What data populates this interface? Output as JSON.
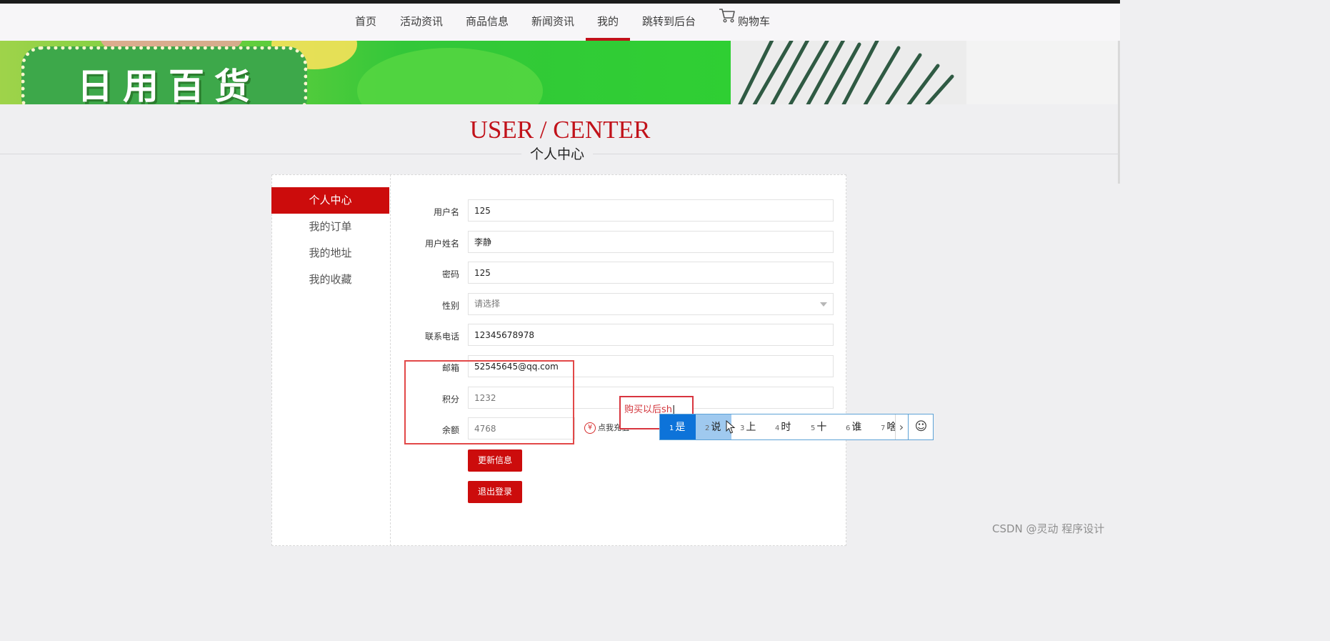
{
  "nav": {
    "items": [
      "首页",
      "活动资讯",
      "商品信息",
      "新闻资讯",
      "我的",
      "跳转到后台"
    ],
    "cart_label": "购物车",
    "active_item": "我的"
  },
  "banner": {
    "text": "日用百货"
  },
  "heading": {
    "en": "USER / CENTER",
    "cn": "个人中心"
  },
  "sidebar": {
    "items": [
      "个人中心",
      "我的订单",
      "我的地址",
      "我的收藏"
    ]
  },
  "form": {
    "username_label": "用户名",
    "username_value": "125",
    "realname_label": "用户姓名",
    "realname_value": "李静",
    "password_label": "密码",
    "password_value": "125",
    "gender_label": "性别",
    "gender_placeholder": "请选择",
    "phone_label": "联系电话",
    "phone_value": "12345678978",
    "email_label": "邮箱",
    "email_value": "52545645@qq.com",
    "points_label": "积分",
    "points_value": "1232",
    "balance_label": "余额",
    "balance_value": "4768",
    "recharge_label": "点我充值",
    "update_button": "更新信息",
    "logout_button": "退出登录"
  },
  "ime": {
    "composition": "购买以后sh",
    "candidates": [
      {
        "num": "1",
        "text": "是"
      },
      {
        "num": "2",
        "text": "说"
      },
      {
        "num": "3",
        "text": "上"
      },
      {
        "num": "4",
        "text": "时"
      },
      {
        "num": "5",
        "text": "十"
      },
      {
        "num": "6",
        "text": "谁"
      },
      {
        "num": "7",
        "text": "啥"
      }
    ],
    "next_glyph": "›",
    "emoji_glyph": "☺"
  },
  "watermark": "CSDN @灵动 程序设计",
  "colors": {
    "accent": "#cc0c0c",
    "title_red": "#c1121a",
    "ime_blue": "#0d73d9"
  }
}
